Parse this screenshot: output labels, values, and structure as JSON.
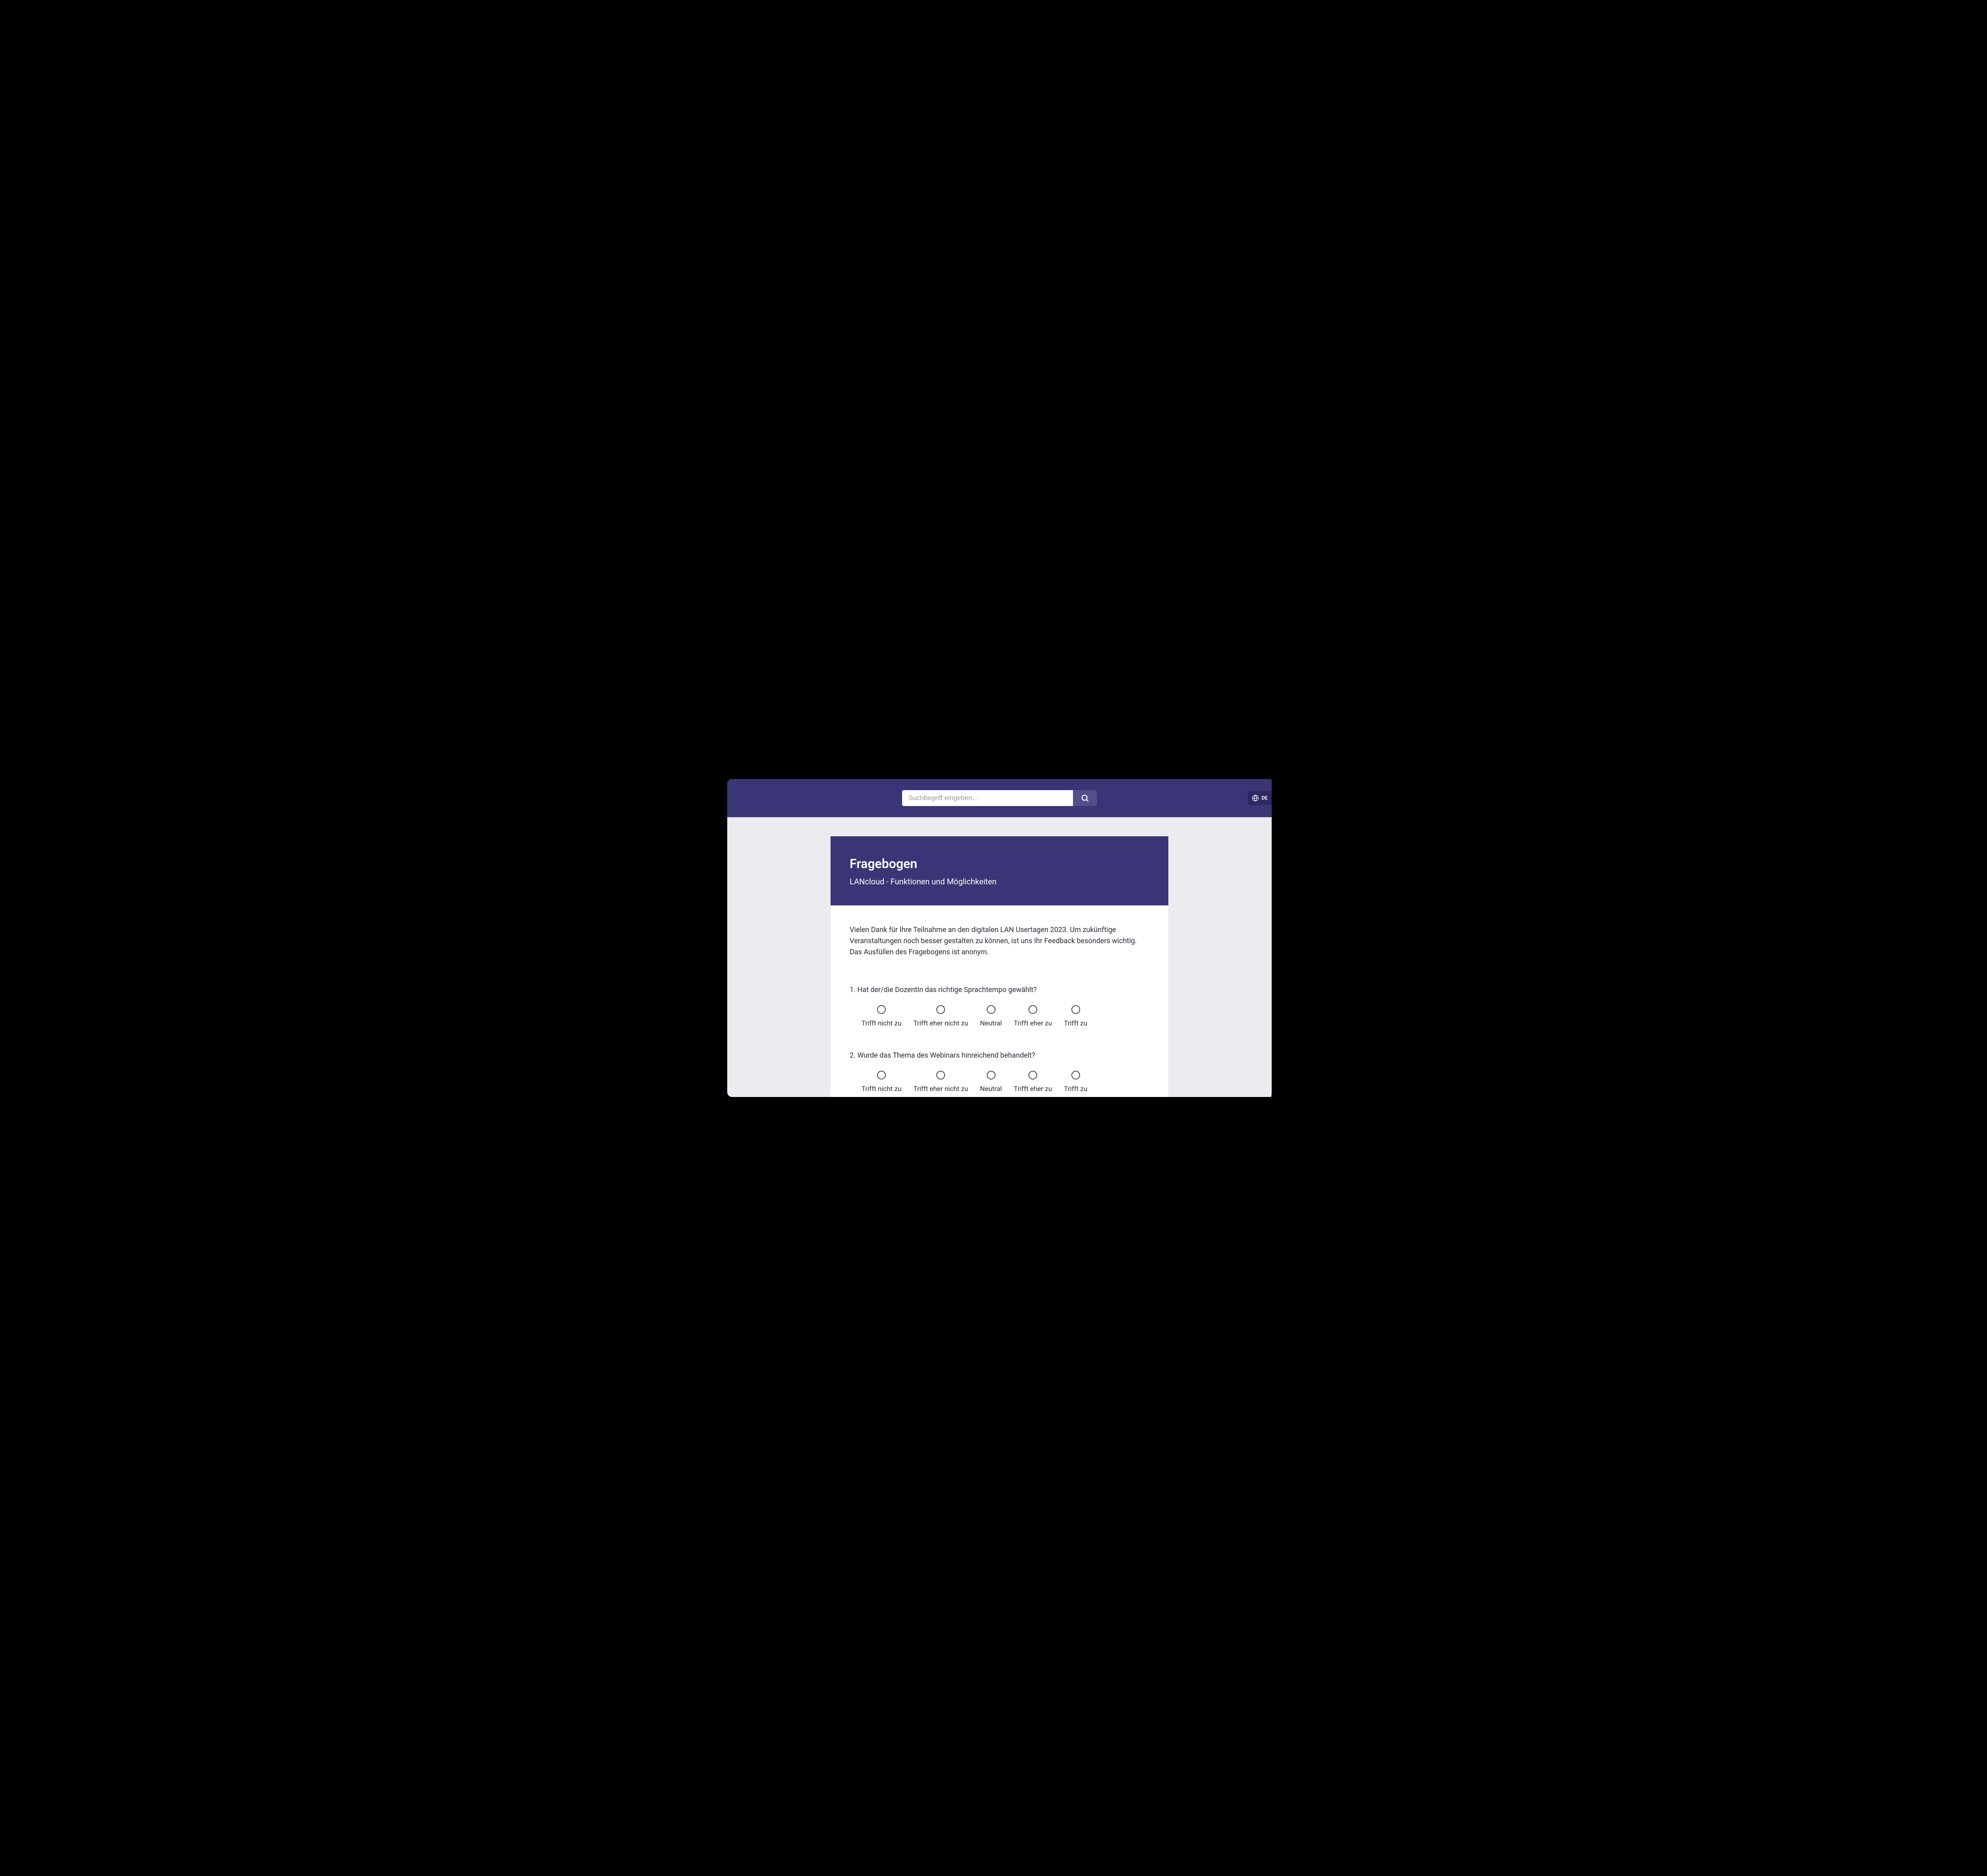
{
  "header": {
    "search_placeholder": "Suchbegriff eingeben...",
    "language_code": "DE"
  },
  "form": {
    "title": "Fragebogen",
    "subtitle": "LANcloud - Funktionen und Möglichkeiten",
    "intro": "Vielen Dank für Ihre Teilnahme an den digitalen LAN Usertagen 2023. Um zukünftige Veranstaltungen noch besser gestalten zu können, ist uns Ihr Feedback besonders wichtig. Das Ausfüllen des Fragebogens ist anonym.",
    "questions": [
      {
        "number": "1",
        "text": "Hat der/die DozentIn das richtige Sprachtempo gewählt?"
      },
      {
        "number": "2",
        "text": "Wurde das Thema des Webinars hinreichend behandelt?"
      }
    ],
    "likert_options": [
      "Trifft nicht zu",
      "Trifft eher nicht zu",
      "Neutral",
      "Trifft eher zu",
      "Trifft zu"
    ]
  }
}
